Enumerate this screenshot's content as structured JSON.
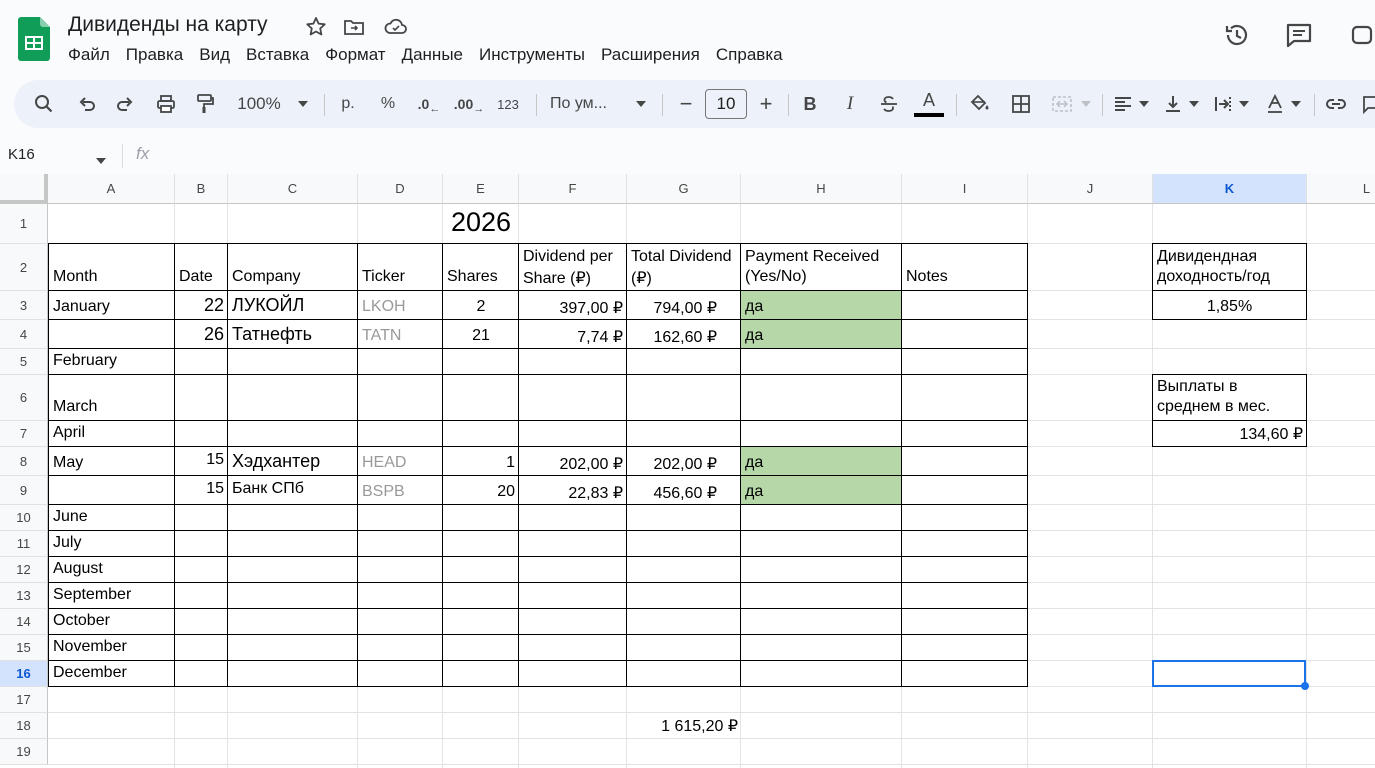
{
  "app": {
    "doc_title": "Дивиденды на карту",
    "menu": [
      "Файл",
      "Правка",
      "Вид",
      "Вставка",
      "Формат",
      "Данные",
      "Инструменты",
      "Расширения",
      "Справка"
    ]
  },
  "toolbar": {
    "zoom": "100%",
    "currency": "р.",
    "percent": "%",
    "dec_decrease": ".0",
    "dec_increase": ".00",
    "number_format": "123",
    "font": "По ум...",
    "font_size": "10",
    "minus": "−",
    "plus": "+",
    "bold": "B",
    "italic": "I",
    "text_color": "A"
  },
  "formula_bar": {
    "cell_ref": "K16",
    "fx": "fx",
    "value": ""
  },
  "columns": [
    "A",
    "B",
    "C",
    "D",
    "E",
    "F",
    "G",
    "H",
    "I",
    "J",
    "K",
    "L"
  ],
  "selected_column": "K",
  "rows": [
    "1",
    "2",
    "3",
    "4",
    "5",
    "6",
    "7",
    "8",
    "9",
    "10",
    "11",
    "12",
    "13",
    "14",
    "15",
    "16",
    "17",
    "18",
    "19"
  ],
  "selected_row": "16",
  "sheet": {
    "year": "2026",
    "headers": {
      "month": "Month",
      "date": "Date",
      "company": "Company",
      "ticker": "Ticker",
      "shares": "Shares",
      "div_per_share_1": "Dividend per",
      "div_per_share_2": "Share (₽)",
      "total_div_1": "Total Dividend",
      "total_div_2": "(₽)",
      "payment_1": "Payment Received",
      "payment_2": "(Yes/No)",
      "notes": "Notes"
    },
    "months": [
      "January",
      "February",
      "March",
      "April",
      "May",
      "June",
      "July",
      "August",
      "September",
      "October",
      "November",
      "December"
    ],
    "entries": [
      {
        "date": "22",
        "company": "ЛУКОЙЛ",
        "ticker": "LKOH",
        "shares": "2",
        "dps": "397,00 ₽",
        "total": "794,00 ₽",
        "paid": "да"
      },
      {
        "date": "26",
        "company": "Татнефть",
        "ticker": "TATN",
        "shares": "21",
        "dps": "7,74 ₽",
        "total": "162,60 ₽",
        "paid": "да"
      },
      {
        "date": "15",
        "company": "Хэдхантер",
        "ticker": "HEAD",
        "shares": "1",
        "dps": "202,00 ₽",
        "total": "202,00 ₽",
        "paid": "да"
      },
      {
        "date": "15",
        "company": "Банк СПб",
        "ticker": "BSPB",
        "shares": "20",
        "dps": "22,83 ₽",
        "total": "456,60 ₽",
        "paid": "да"
      }
    ],
    "grand_total": "1 615,20 ₽",
    "side": {
      "yield_label_1": "Дивидендная",
      "yield_label_2": "доходность/год",
      "yield_value": "1,85%",
      "avg_label_1": "Выплаты в",
      "avg_label_2": "среднем в мес.",
      "avg_value": "134,60 ₽"
    }
  },
  "colors": {
    "green_fill": "#b6d7a8",
    "selection": "#1a73e8",
    "ticker_gray": "#999999",
    "logo_green": "#0f9d58"
  }
}
